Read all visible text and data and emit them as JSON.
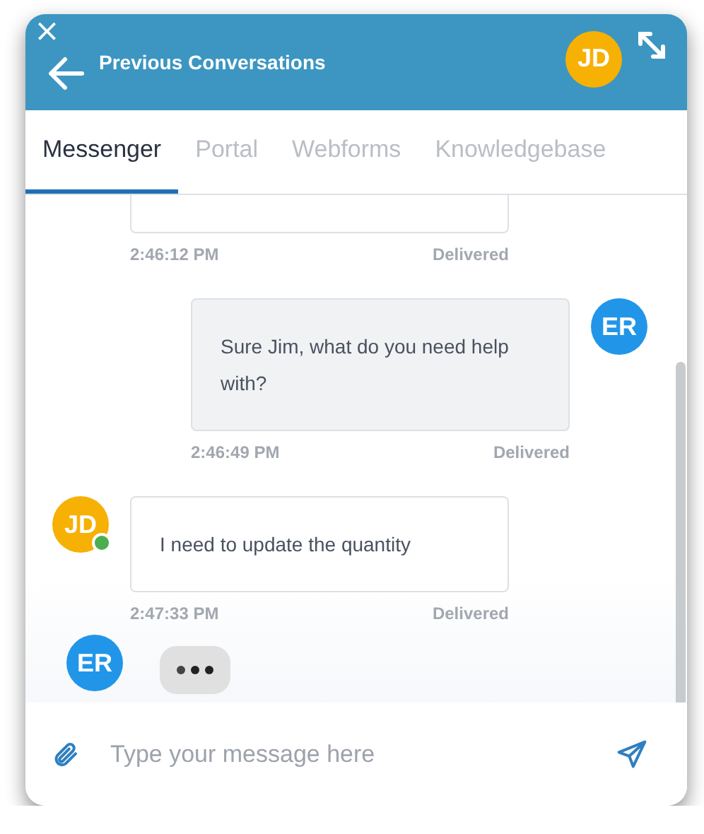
{
  "header": {
    "close": "×",
    "title": "Previous Conversations",
    "avatar": "JD"
  },
  "tabs": [
    {
      "label": "Messenger",
      "selected": true
    },
    {
      "label": "Portal",
      "selected": false
    },
    {
      "label": "Webforms",
      "selected": false
    },
    {
      "label": "Knowledgebase",
      "selected": false
    }
  ],
  "messages": [
    {
      "kind": "customer",
      "time": "2:46:12 PM",
      "status": "Delivered",
      "cut": true
    },
    {
      "kind": "agent",
      "text": "Sure Jim, what do you need help with?",
      "time": "2:46:49 PM",
      "status": "Delivered",
      "avatar": "ER",
      "online": false,
      "cut": false
    },
    {
      "kind": "customer",
      "text": "I need to update the quantity",
      "time": "2:47:33 PM",
      "status": "Delivered",
      "avatar": "JD",
      "online": true,
      "cut": false
    }
  ],
  "typing": {
    "avatar": "ER"
  },
  "composer": {
    "placeholder": "Type your message here"
  }
}
